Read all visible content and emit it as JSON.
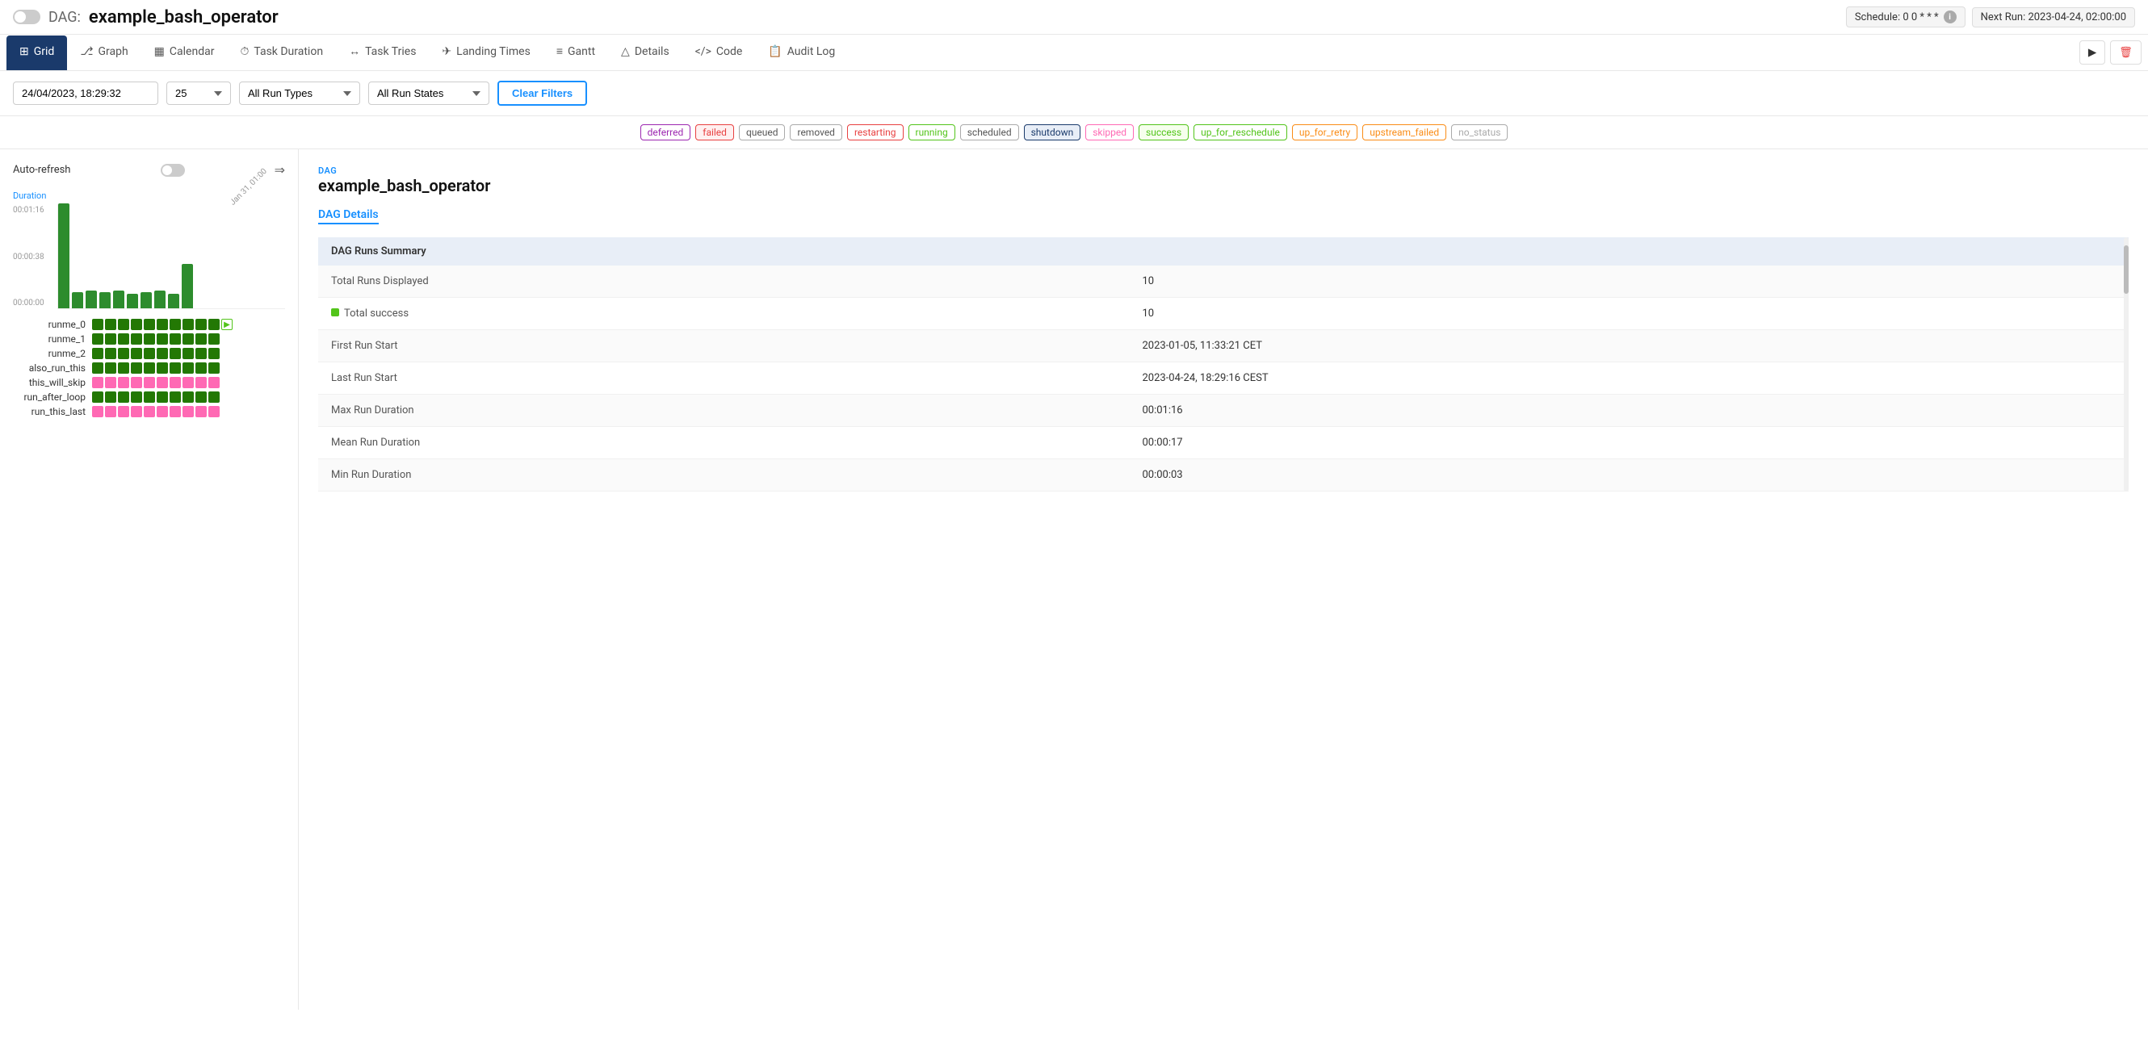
{
  "header": {
    "toggle_label": "off",
    "dag_label": "DAG:",
    "dag_name": "example_bash_operator",
    "schedule_label": "Schedule: 0 0 * * *",
    "info_icon": "i",
    "next_run_label": "Next Run: 2023-04-24, 02:00:00"
  },
  "nav": {
    "tabs": [
      {
        "id": "grid",
        "label": "Grid",
        "icon": "⊞",
        "active": true
      },
      {
        "id": "graph",
        "label": "Graph",
        "icon": "⎇"
      },
      {
        "id": "calendar",
        "label": "Calendar",
        "icon": "📅"
      },
      {
        "id": "task-duration",
        "label": "Task Duration",
        "icon": "⧗"
      },
      {
        "id": "task-tries",
        "label": "Task Tries",
        "icon": "↔"
      },
      {
        "id": "landing-times",
        "label": "Landing Times",
        "icon": "✈"
      },
      {
        "id": "gantt",
        "label": "Gantt",
        "icon": "≡"
      },
      {
        "id": "details",
        "label": "Details",
        "icon": "△"
      },
      {
        "id": "code",
        "label": "Code",
        "icon": "</>"
      },
      {
        "id": "audit-log",
        "label": "Audit Log",
        "icon": "📋"
      }
    ],
    "play_icon": "▶",
    "delete_icon": "🗑"
  },
  "filters": {
    "date_value": "24/04/2023, 18:29:32",
    "count_value": "25",
    "run_type_placeholder": "All Run Types",
    "run_state_placeholder": "All Run States",
    "clear_button": "Clear Filters"
  },
  "status_badges": [
    {
      "id": "deferred",
      "label": "deferred",
      "class": "badge-deferred"
    },
    {
      "id": "failed",
      "label": "failed",
      "class": "badge-failed"
    },
    {
      "id": "queued",
      "label": "queued",
      "class": "badge-queued"
    },
    {
      "id": "removed",
      "label": "removed",
      "class": "badge-removed"
    },
    {
      "id": "restarting",
      "label": "restarting",
      "class": "badge-restarting"
    },
    {
      "id": "running",
      "label": "running",
      "class": "badge-running"
    },
    {
      "id": "scheduled",
      "label": "scheduled",
      "class": "badge-scheduled"
    },
    {
      "id": "shutdown",
      "label": "shutdown",
      "class": "badge-shutdown"
    },
    {
      "id": "skipped",
      "label": "skipped",
      "class": "badge-skipped"
    },
    {
      "id": "success",
      "label": "success",
      "class": "badge-success"
    },
    {
      "id": "up_for_reschedule",
      "label": "up_for_reschedule",
      "class": "badge-up-for-reschedule"
    },
    {
      "id": "up_for_retry",
      "label": "up_for_retry",
      "class": "badge-up-for-retry"
    },
    {
      "id": "upstream_failed",
      "label": "upstream_failed",
      "class": "badge-upstream-failed"
    },
    {
      "id": "no_status",
      "label": "no_status",
      "class": "badge-no-status"
    }
  ],
  "left_panel": {
    "auto_refresh_label": "Auto-refresh",
    "chart": {
      "duration_label": "Duration",
      "date_label": "Jan 31, 01:00",
      "y_labels": [
        "00:01:16",
        "00:00:38",
        "00:00:00"
      ],
      "bars": [
        {
          "height": 130,
          "color": "#52c41a"
        },
        {
          "height": 20,
          "color": "#52c41a"
        },
        {
          "height": 22,
          "color": "#52c41a"
        },
        {
          "height": 22,
          "color": "#52c41a"
        },
        {
          "height": 20,
          "color": "#52c41a"
        },
        {
          "height": 18,
          "color": "#52c41a"
        },
        {
          "height": 20,
          "color": "#52c41a"
        },
        {
          "height": 22,
          "color": "#52c41a"
        },
        {
          "height": 18,
          "color": "#52c41a"
        },
        {
          "height": 55,
          "color": "#52c41a"
        }
      ]
    },
    "rows": [
      {
        "label": "runme_0",
        "cells": [
          "green",
          "green",
          "green",
          "green",
          "green",
          "green",
          "green",
          "green",
          "green",
          "green",
          "arrow"
        ],
        "type": "mixed"
      },
      {
        "label": "runme_1",
        "cells": [
          "green",
          "green",
          "green",
          "green",
          "green",
          "green",
          "green",
          "green",
          "green",
          "green"
        ],
        "type": "green"
      },
      {
        "label": "runme_2",
        "cells": [
          "green",
          "green",
          "green",
          "green",
          "green",
          "green",
          "green",
          "green",
          "green",
          "green"
        ],
        "type": "green"
      },
      {
        "label": "also_run_this",
        "cells": [
          "green",
          "green",
          "green",
          "green",
          "green",
          "green",
          "green",
          "green",
          "green",
          "green"
        ],
        "type": "green"
      },
      {
        "label": "this_will_skip",
        "cells": [
          "pink",
          "pink",
          "pink",
          "pink",
          "pink",
          "pink",
          "pink",
          "pink",
          "pink",
          "pink"
        ],
        "type": "pink"
      },
      {
        "label": "run_after_loop",
        "cells": [
          "green",
          "green",
          "green",
          "green",
          "green",
          "green",
          "green",
          "green",
          "green",
          "green"
        ],
        "type": "green"
      },
      {
        "label": "run_this_last",
        "cells": [
          "pink",
          "pink",
          "pink",
          "pink",
          "pink",
          "pink",
          "pink",
          "pink",
          "pink",
          "pink"
        ],
        "type": "pink"
      }
    ]
  },
  "right_panel": {
    "dag_subtitle": "DAG",
    "dag_name": "example_bash_operator",
    "details_link": "DAG Details",
    "table": {
      "header": "DAG Runs Summary",
      "rows": [
        {
          "label": "Total Runs Displayed",
          "value": "10"
        },
        {
          "label": "Total success",
          "value": "10",
          "has_dot": true
        },
        {
          "label": "First Run Start",
          "value": "2023-01-05, 11:33:21 CET"
        },
        {
          "label": "Last Run Start",
          "value": "2023-04-24, 18:29:16 CEST"
        },
        {
          "label": "Max Run Duration",
          "value": "00:01:16"
        },
        {
          "label": "Mean Run Duration",
          "value": "00:00:17"
        },
        {
          "label": "Min Run Duration",
          "value": "00:00:03"
        }
      ]
    }
  }
}
